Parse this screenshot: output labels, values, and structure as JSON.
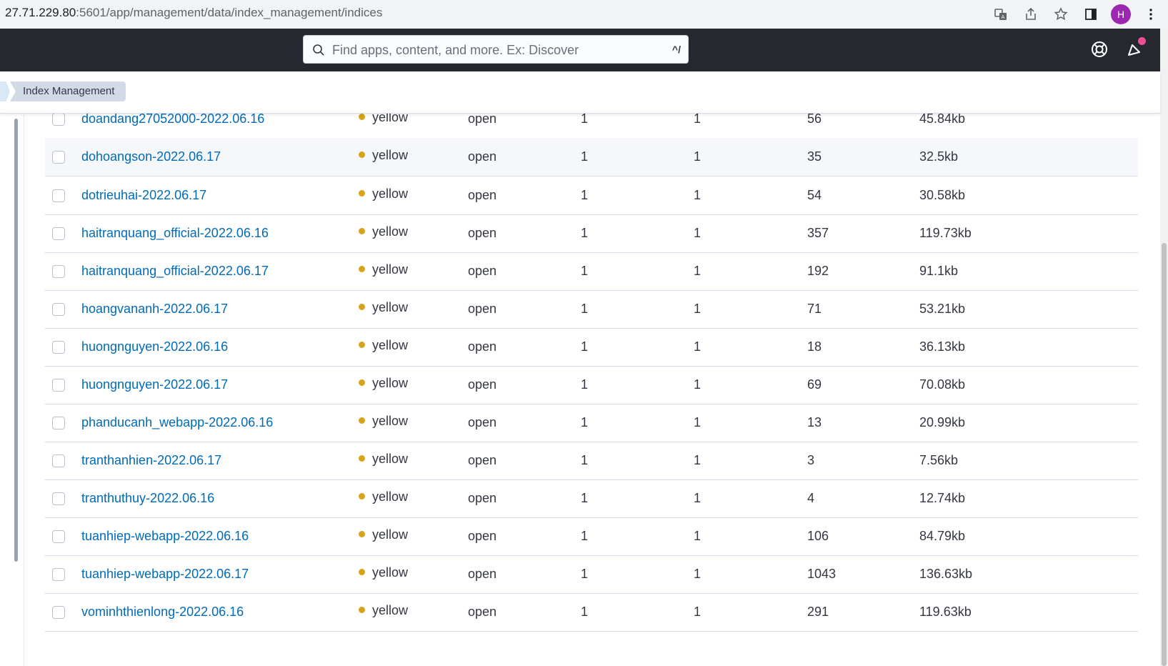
{
  "browser": {
    "url_host": "27.71.229.80",
    "url_path": ":5601/app/management/data/index_management/indices",
    "profile_initial": "H"
  },
  "header": {
    "search_placeholder": "Find apps, content, and more. Ex: Discover",
    "search_shortcut": "^/"
  },
  "breadcrumb": {
    "current": "Index Management"
  },
  "colors": {
    "link": "#006bb8",
    "health_yellow": "#d6a41a",
    "header_bg": "#25282f"
  },
  "indices": [
    {
      "name": "doandang27052000-2022.06.16",
      "health": "yellow",
      "status": "open",
      "primaries": "1",
      "replicas": "1",
      "docs": "56",
      "size": "45.84kb"
    },
    {
      "name": "dohoangson-2022.06.17",
      "health": "yellow",
      "status": "open",
      "primaries": "1",
      "replicas": "1",
      "docs": "35",
      "size": "32.5kb"
    },
    {
      "name": "dotrieuhai-2022.06.17",
      "health": "yellow",
      "status": "open",
      "primaries": "1",
      "replicas": "1",
      "docs": "54",
      "size": "30.58kb"
    },
    {
      "name": "haitranquang_official-2022.06.16",
      "health": "yellow",
      "status": "open",
      "primaries": "1",
      "replicas": "1",
      "docs": "357",
      "size": "119.73kb"
    },
    {
      "name": "haitranquang_official-2022.06.17",
      "health": "yellow",
      "status": "open",
      "primaries": "1",
      "replicas": "1",
      "docs": "192",
      "size": "91.1kb"
    },
    {
      "name": "hoangvananh-2022.06.17",
      "health": "yellow",
      "status": "open",
      "primaries": "1",
      "replicas": "1",
      "docs": "71",
      "size": "53.21kb"
    },
    {
      "name": "huongnguyen-2022.06.16",
      "health": "yellow",
      "status": "open",
      "primaries": "1",
      "replicas": "1",
      "docs": "18",
      "size": "36.13kb"
    },
    {
      "name": "huongnguyen-2022.06.17",
      "health": "yellow",
      "status": "open",
      "primaries": "1",
      "replicas": "1",
      "docs": "69",
      "size": "70.08kb"
    },
    {
      "name": "phanducanh_webapp-2022.06.16",
      "health": "yellow",
      "status": "open",
      "primaries": "1",
      "replicas": "1",
      "docs": "13",
      "size": "20.99kb"
    },
    {
      "name": "tranthanhien-2022.06.17",
      "health": "yellow",
      "status": "open",
      "primaries": "1",
      "replicas": "1",
      "docs": "3",
      "size": "7.56kb"
    },
    {
      "name": "tranthuthuy-2022.06.16",
      "health": "yellow",
      "status": "open",
      "primaries": "1",
      "replicas": "1",
      "docs": "4",
      "size": "12.74kb"
    },
    {
      "name": "tuanhiep-webapp-2022.06.16",
      "health": "yellow",
      "status": "open",
      "primaries": "1",
      "replicas": "1",
      "docs": "106",
      "size": "84.79kb"
    },
    {
      "name": "tuanhiep-webapp-2022.06.17",
      "health": "yellow",
      "status": "open",
      "primaries": "1",
      "replicas": "1",
      "docs": "1043",
      "size": "136.63kb"
    },
    {
      "name": "vominhthienlong-2022.06.16",
      "health": "yellow",
      "status": "open",
      "primaries": "1",
      "replicas": "1",
      "docs": "291",
      "size": "119.63kb"
    }
  ]
}
